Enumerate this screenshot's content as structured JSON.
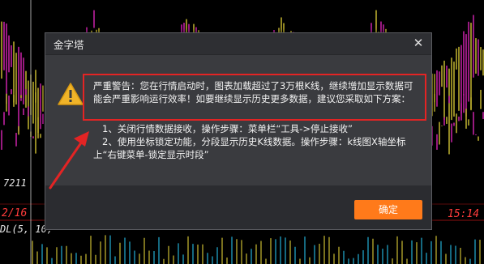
{
  "background": {
    "left_price_label": "7211",
    "left_date_label": "2/16",
    "right_time_label": "15:14",
    "indicator_label": "DL(5, 10, ",
    "colors": {
      "candle_magenta": "#ff2bd6",
      "candle_yellow": "#f5e23c",
      "date_red": "#ff3b3b"
    }
  },
  "dialog": {
    "title": "金字塔",
    "close_glyph": "✕",
    "warning_icon": "warning-icon",
    "message": "严重警告：您在行情启动时，图表加载超过了3万根K线，继续增加显示数据可能会严重影响运行效率！如要继续显示历史更多数据，建议您采取如下方案：",
    "step1": "1、关闭行情数据接收，操作步骤：菜单栏“工具->停止接收”",
    "step2": "2、使用坐标锁定功能，分段显示历史K线数据。操作步骤：k线图X轴坐标上“右键菜单-锁定显示时段”",
    "ok_label": "确定",
    "colors": {
      "accent": "#ff7a1a",
      "highlight_border": "#e32424",
      "warning_yellow": "#f0b429"
    }
  }
}
